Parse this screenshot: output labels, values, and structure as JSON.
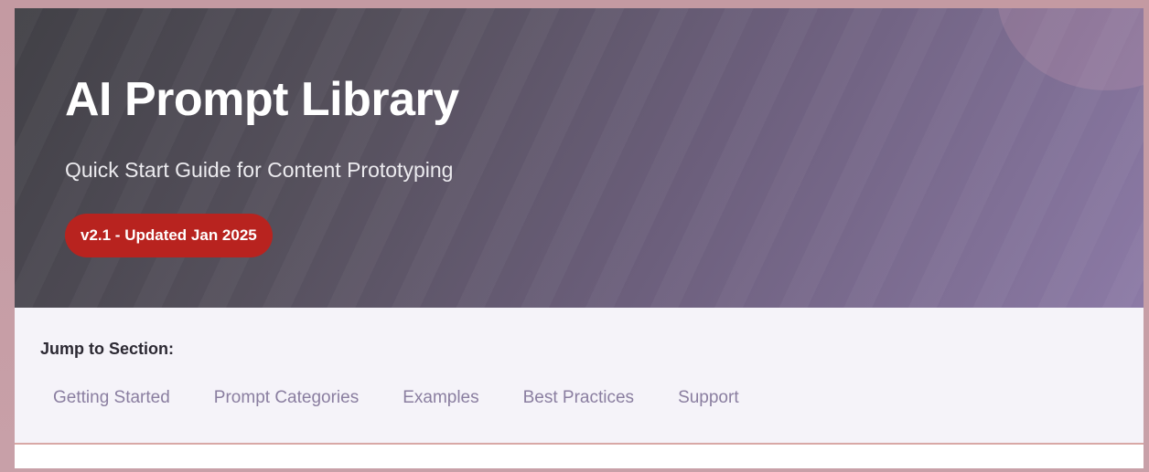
{
  "hero": {
    "title": "AI Prompt Library",
    "subtitle": "Quick Start Guide for Content Prototyping",
    "badge": "v2.1 - Updated Jan 2025"
  },
  "nav": {
    "heading": "Jump to Section:",
    "links": [
      {
        "label": "Getting Started"
      },
      {
        "label": "Prompt Categories"
      },
      {
        "label": "Examples"
      },
      {
        "label": "Best Practices"
      },
      {
        "label": "Support"
      }
    ]
  },
  "colors": {
    "badge_bg": "#b8231f",
    "link": "#8a7ea0",
    "hero_start": "#414046",
    "hero_end": "#8c7aa6",
    "nav_bg": "#f5f3f9",
    "border_accent": "#d8a8a6"
  }
}
